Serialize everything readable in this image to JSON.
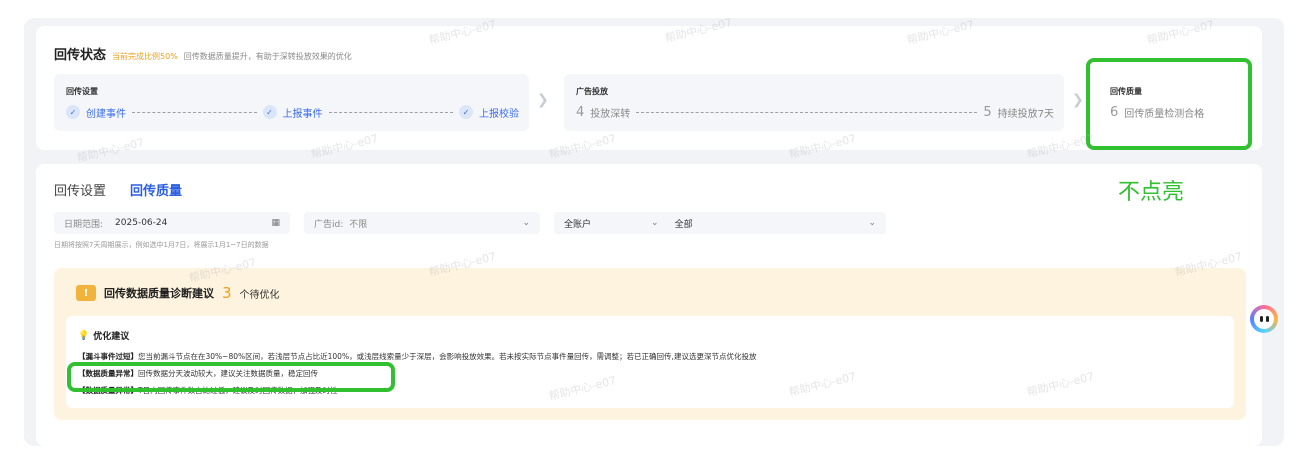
{
  "status": {
    "title": "回传状态",
    "completion": "当前完成比例50%",
    "desc": "回传数据质量提升，有助于深转投放效果的优化",
    "steps": [
      {
        "title": "回传设置",
        "events": [
          "创建事件",
          "上报事件",
          "上报校验"
        ]
      },
      {
        "title": "广告投放",
        "items": [
          {
            "num": "4",
            "label": "投放深转"
          },
          {
            "num": "5",
            "label": "持续投放7天"
          }
        ]
      },
      {
        "title": "回传质量",
        "items": [
          {
            "num": "6",
            "label": "回传质量检测合格"
          }
        ]
      }
    ]
  },
  "annotation": "不点亮",
  "tabs": [
    {
      "label": "回传设置",
      "active": false
    },
    {
      "label": "回传质量",
      "active": true
    }
  ],
  "filters": {
    "date_label": "日期范围:",
    "date_value": "2025-06-24",
    "ad_label": "广告id:",
    "ad_value": "不限",
    "account_value": "全账户",
    "all_value": "全部"
  },
  "hint": "日期将按照7天周期展示，例如选中1月7日，将展示1月1~7日的数据",
  "diagnosis": {
    "title": "回传数据质量诊断建议",
    "count": "3",
    "pending": "个待优化",
    "section_title": "优化建议",
    "lines": [
      {
        "tag": "【漏斗事件过短】",
        "text": "您当前漏斗节点在在30%~80%区间，若浅层节点占比近100%，或浅层线索量少于深层，会影响投放效果。若未按实际节点事件量回传，需调整；若已正确回传,建议选更深节点优化投放"
      },
      {
        "tag": "【数据质量异常】",
        "text": "回传数据分天波动较大，建议关注数据质量，稳定回传"
      },
      {
        "tag": "【数据质量异常】",
        "text": "T日内回传事件数占比过低，建议及时回传数据，加强及时性"
      }
    ]
  },
  "watermark": "帮助中心-e07",
  "colors": {
    "accent": "#2b5fe0",
    "highlight": "#30c030",
    "warning": "#f0a020"
  }
}
